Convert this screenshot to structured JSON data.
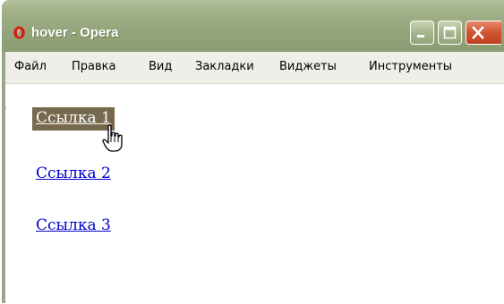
{
  "window": {
    "title": "hover - Opera",
    "colors": {
      "frame": "#9aa886",
      "close": "#d0532f",
      "link": "#0000cc",
      "hover_bg": "#76694d"
    }
  },
  "titlebar_buttons": [
    {
      "name": "minimize",
      "icon": "minimize-icon"
    },
    {
      "name": "maximize",
      "icon": "maximize-icon"
    },
    {
      "name": "close",
      "icon": "close-icon"
    }
  ],
  "menubar": {
    "items": [
      "Файл",
      "Правка",
      "Вид",
      "Закладки",
      "Виджеты",
      "Инструменты"
    ]
  },
  "content": {
    "links": [
      {
        "label": "Ссылка 1",
        "state": "hover"
      },
      {
        "label": "Ссылка 2",
        "state": "normal"
      },
      {
        "label": "Ссылка 3",
        "state": "normal"
      }
    ]
  },
  "cursor": {
    "icon": "hand-pointer-icon"
  }
}
